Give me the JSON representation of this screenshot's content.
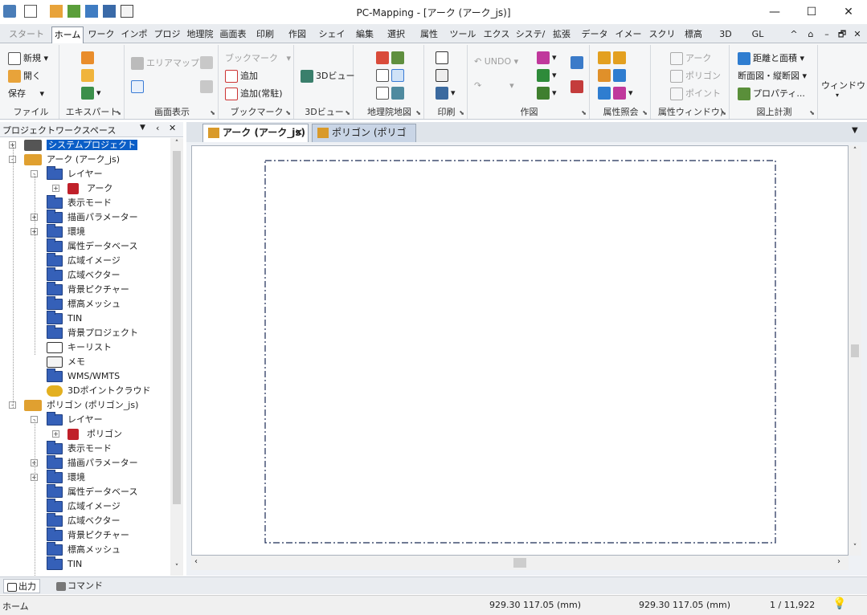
{
  "window": {
    "title": "PC-Mapping - [アーク (アーク_js)]",
    "minimize": "—",
    "maximize": "☐",
    "close": "✕"
  },
  "tabs": [
    "スタート",
    "ホーム",
    "ワークス",
    "インポー",
    "プロジェ",
    "地理院",
    "画面表",
    "印刷",
    "作図",
    "シェイプ",
    "編集",
    "選択",
    "属性",
    "ツール",
    "エクスオ",
    "システ/",
    "拡張",
    "データ^",
    "イメージ",
    "スクリプ",
    "標高",
    "3D",
    "GL"
  ],
  "tab_controls": [
    "^",
    "⌂",
    "–",
    "🗗",
    "✕"
  ],
  "ribbon": {
    "file": {
      "new": "新規",
      "open": "開く",
      "save": "保存",
      "label": "ファイル"
    },
    "expert": {
      "label": "エキスパート"
    },
    "view": {
      "area_map": "エリアマップ",
      "label": "画面表示"
    },
    "bookmark": {
      "bookmark": "ブックマーク",
      "add": "追加",
      "add_always": "追加(常駐)",
      "label": "ブックマーク"
    },
    "view3d": {
      "btn": "3Dビュー",
      "label": "3Dビュー"
    },
    "gsi": {
      "label": "地理院地図"
    },
    "print": {
      "label": "印刷"
    },
    "draw": {
      "undo": "UNDO",
      "label": "作図"
    },
    "attr_ref": {
      "label": "属性照会"
    },
    "attr_win": {
      "arc": "アーク",
      "polygon": "ポリゴン",
      "point": "ポイント",
      "label": "属性ウィンドウ)"
    },
    "measure": {
      "dist_area": "距離と面積",
      "section": "断面図・縦断図",
      "property": "プロパティ...",
      "label": "図上計測"
    },
    "window": {
      "label": "ウィンドウ"
    }
  },
  "panel": {
    "title": "プロジェクトワークスペース",
    "controls": [
      "▼",
      "‹",
      "✕"
    ]
  },
  "tree": [
    {
      "label": "システムプロジェクト",
      "level": 0,
      "kind": "system",
      "expander": "+",
      "selected": true
    },
    {
      "label": "アーク (アーク_js)",
      "level": 0,
      "kind": "project",
      "expander": "-"
    },
    {
      "label": "レイヤー",
      "level": 1,
      "kind": "open",
      "expander": "-"
    },
    {
      "label": "アーク",
      "level": 2,
      "kind": "layer",
      "expander": "+"
    },
    {
      "label": "表示モード",
      "level": 1,
      "kind": "folder",
      "expander": ""
    },
    {
      "label": "描画パラメーター",
      "level": 1,
      "kind": "folder",
      "expander": "+"
    },
    {
      "label": "環境",
      "level": 1,
      "kind": "folder",
      "expander": "+"
    },
    {
      "label": "属性データベース",
      "level": 1,
      "kind": "folder",
      "expander": ""
    },
    {
      "label": "広域イメージ",
      "level": 1,
      "kind": "folder",
      "expander": ""
    },
    {
      "label": "広域ベクター",
      "level": 1,
      "kind": "folder",
      "expander": ""
    },
    {
      "label": "背景ピクチャー",
      "level": 1,
      "kind": "folder",
      "expander": ""
    },
    {
      "label": "標高メッシュ",
      "level": 1,
      "kind": "folder",
      "expander": ""
    },
    {
      "label": "TIN",
      "level": 1,
      "kind": "folder",
      "expander": ""
    },
    {
      "label": "背景プロジェクト",
      "level": 1,
      "kind": "folder",
      "expander": ""
    },
    {
      "label": "キーリスト",
      "level": 1,
      "kind": "keylist",
      "expander": ""
    },
    {
      "label": "メモ",
      "level": 1,
      "kind": "memo",
      "expander": ""
    },
    {
      "label": "WMS/WMTS",
      "level": 1,
      "kind": "folder",
      "expander": ""
    },
    {
      "label": "3Dポイントクラウド",
      "level": 1,
      "kind": "cloud",
      "expander": ""
    },
    {
      "label": "ポリゴン (ポリゴン_js)",
      "level": 0,
      "kind": "project",
      "expander": "-"
    },
    {
      "label": "レイヤー",
      "level": 1,
      "kind": "open",
      "expander": "-"
    },
    {
      "label": "ポリゴン",
      "level": 2,
      "kind": "layer",
      "expander": "+"
    },
    {
      "label": "表示モード",
      "level": 1,
      "kind": "folder",
      "expander": ""
    },
    {
      "label": "描画パラメーター",
      "level": 1,
      "kind": "folder",
      "expander": "+"
    },
    {
      "label": "環境",
      "level": 1,
      "kind": "folder",
      "expander": "+"
    },
    {
      "label": "属性データベース",
      "level": 1,
      "kind": "folder",
      "expander": ""
    },
    {
      "label": "広域イメージ",
      "level": 1,
      "kind": "folder",
      "expander": ""
    },
    {
      "label": "広域ベクター",
      "level": 1,
      "kind": "folder",
      "expander": ""
    },
    {
      "label": "背景ピクチャー",
      "level": 1,
      "kind": "folder",
      "expander": ""
    },
    {
      "label": "標高メッシュ",
      "level": 1,
      "kind": "folder",
      "expander": ""
    },
    {
      "label": "TIN",
      "level": 1,
      "kind": "folder",
      "expander": ""
    }
  ],
  "doc_tabs": [
    {
      "label": "アーク (アーク_js)",
      "active": true,
      "close": "✕"
    },
    {
      "label": "ポリゴン (ポリゴン_js)",
      "active": false
    }
  ],
  "bottom_tabs": [
    "出力",
    "コマンド"
  ],
  "status": {
    "mode": "ホーム",
    "coord1": "929.30 117.05 (mm)",
    "coord2": "929.30 117.05 (mm)",
    "scale": "1 / 11,922"
  },
  "colors": {
    "accent": "#0b5ec7",
    "selected_bg": "#0b5ec7",
    "folder": "#3560b8"
  }
}
